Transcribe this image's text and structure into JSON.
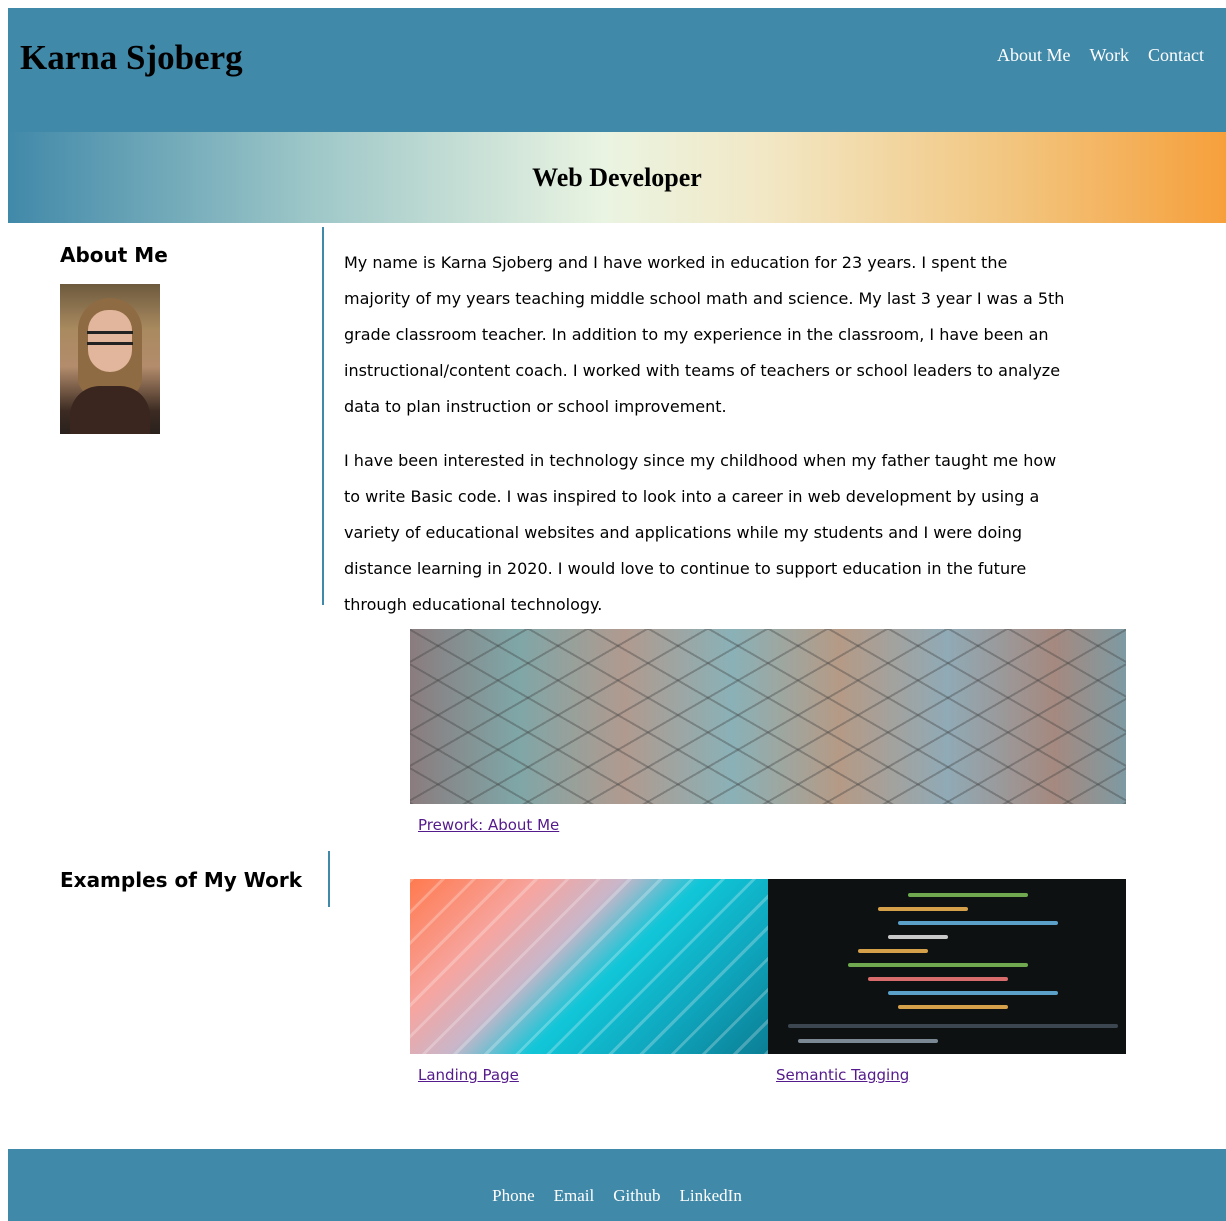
{
  "header": {
    "name": "Karna Sjoberg",
    "nav": [
      "About Me",
      "Work",
      "Contact"
    ]
  },
  "banner": {
    "title": "Web Developer"
  },
  "about": {
    "heading": "About Me",
    "photo_alt": "Karna Sjoberg portrait",
    "paragraphs": [
      "My name is Karna Sjoberg and I have worked in education for 23 years. I spent the majority of my years teaching middle school math and science. My last 3 year I was a 5th grade classroom teacher. In addition to my experience in the classroom, I have been an instructional/content coach. I worked with teams of teachers or school leaders to analyze data to plan instruction or school improvement.",
      "I have been interested in technology since my childhood when my father taught me how to write Basic code. I was inspired to look into a career in web development by using a variety of educational websites and applications while my students and I were doing distance learning in 2020. I would love to continue to support education in the future through educational technology."
    ]
  },
  "work": {
    "heading": "Examples of My Work",
    "projects": [
      {
        "label": "Prework: About Me"
      },
      {
        "label": "Landing Page"
      },
      {
        "label": "Semantic Tagging"
      }
    ]
  },
  "footer": {
    "links": [
      "Phone",
      "Email",
      "Github",
      "LinkedIn"
    ]
  },
  "colors": {
    "header_bg": "#4189a9",
    "link_visited": "#551a8b",
    "gradient_end": "#f6a03c"
  }
}
